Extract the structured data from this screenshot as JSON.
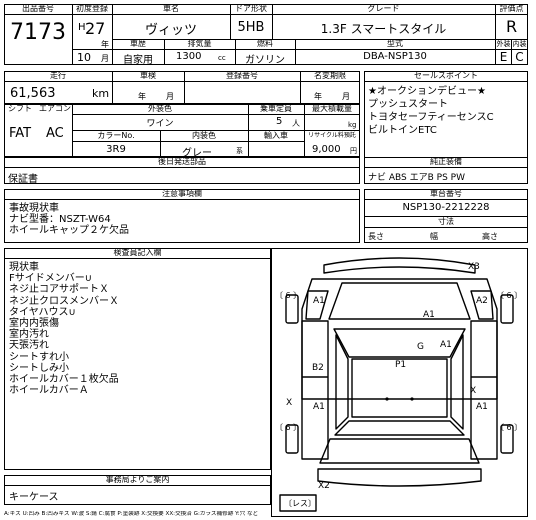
{
  "header": {
    "lot_label": "出品番号",
    "lot_value": "7173",
    "first_reg_label": "初度登録",
    "era": "H",
    "year_value": "27",
    "year_unit": "年",
    "month_value": "10",
    "month_unit": "月",
    "car_name_label": "車名",
    "car_name": "ヴィッツ",
    "doors_label": "ドア形状",
    "doors": "5HB",
    "grade_label": "グレード",
    "grade": "1.3F スマートスタイル",
    "rating_label": "評価点",
    "rating": "R",
    "use_label": "車歴",
    "use_value": "自家用",
    "displacement_label": "排気量",
    "displacement": "1300",
    "displacement_unit": "cc",
    "fuel_label": "燃料",
    "fuel": "ガソリン",
    "model_label": "型式",
    "model": "DBA-NSP130",
    "ext_label": "外装",
    "ext_grade": "E",
    "int_label": "内装",
    "int_grade": "C"
  },
  "row2": {
    "mileage_label": "走行",
    "mileage": "61,563",
    "mileage_unit": "km",
    "inspection_label": "車検",
    "insp_year_unit": "年",
    "insp_month_unit": "月",
    "plate_label": "登録番号",
    "name_change_label": "名変期限",
    "nc_year_unit": "年",
    "nc_month_unit": "月",
    "sales_label": "セールスポイント",
    "sales_points": [
      "★オークションデビュー★",
      "プッシュスタート",
      "トヨタセーフティーセンスC",
      "ビルトインETC"
    ]
  },
  "row3": {
    "shift_label": "シフト",
    "ac_label": "エアコン",
    "shift": "FAT",
    "ac": "AC",
    "ext_color_label": "外装色",
    "ext_color": "ワイン",
    "capacity_label": "乗車定員",
    "capacity": "5",
    "capacity_unit": "人",
    "load_label": "最大積載量",
    "load_unit": "kg",
    "color_no_label": "カラーNo.",
    "color_no": "3R9",
    "int_color_label": "内装色",
    "int_color": "グレー",
    "int_color_unit": "系",
    "import_label": "輸入車",
    "recycle_label": "リサイクル料預託",
    "recycle": "9,000",
    "recycle_unit": "円"
  },
  "docs": {
    "label": "後日発送部品",
    "value": "保証書",
    "equip_label": "純正装備",
    "equip": "ナビ ABS エアB PS PW"
  },
  "notes": {
    "label": "注意事項欄",
    "items": [
      "事故現状車",
      "ナビ型番：NSZT-W64",
      "ホイールキャップ２ケ欠品"
    ],
    "chassis_label": "車台番号",
    "chassis": "NSP130-2212228",
    "dims_label": "寸法",
    "length_label": "長さ",
    "width_label": "幅",
    "height_label": "高さ"
  },
  "inspection": {
    "label": "検査員記入欄",
    "items": [
      "現状車",
      "Fサイドメンバー∪",
      "ネジ止コアサポートＸ",
      "ネジ止クロスメンバーＸ",
      "タイヤハウス∪",
      "室内内張傷",
      "室内汚れ",
      "天張汚れ",
      "シートすれ小",
      "シートしみ小",
      "ホイールカバー１枚欠品",
      "ホイールカバーＡ"
    ]
  },
  "diagram": {
    "labels": {
      "x3": "X3",
      "a1_fl": "A1",
      "a2_fr": "A2",
      "a1_hood": "A1",
      "g": "G",
      "a1_ws": "A1",
      "p1": "P1",
      "b2": "B2",
      "x_rl": "X",
      "a1_rl": "A1",
      "x_rr": "X",
      "a1_rr": "A1",
      "x2": "X2",
      "bracket_fl": "〔 6 〕",
      "bracket_fr": "〔 6 〕",
      "bracket_rl": "〔 6 〕",
      "bracket_rr": "〔 6 〕",
      "spare": "〔レス〕"
    }
  },
  "bottom": {
    "label": "事務局よりご案内",
    "value": "キーケース"
  },
  "legend": "A:キズ U:凹み B:凹みキズ W:波 S:錆 C:腐食 P:塗装跡 X:交換要 XX:交換済 G:ガラス補修跡 Y:穴 など"
}
